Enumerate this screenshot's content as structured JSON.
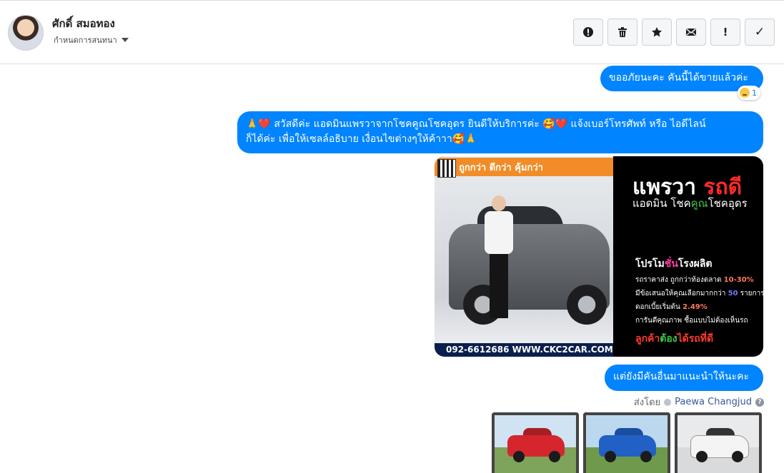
{
  "header": {
    "contact_name": "ศักดิ์ สมอทอง",
    "subtitle": "กำหนดการสนทนา",
    "actions": [
      {
        "icon": "alert-circle-icon",
        "glyph": ""
      },
      {
        "icon": "trash-icon",
        "glyph": ""
      },
      {
        "icon": "star-icon",
        "glyph": ""
      },
      {
        "icon": "envelope-icon",
        "glyph": ""
      },
      {
        "icon": "exclamation-icon",
        "glyph": "!"
      },
      {
        "icon": "checkmark-icon",
        "glyph": "✓"
      }
    ]
  },
  "messages": {
    "m1": "ขออภัยนะคะ คันนี้ได้ขายแล้วค่ะ",
    "m1_reaction_count": "1",
    "m2_line1": "🙏❤️ สวัสดีค่ะ แอดมินแพรวาจากโชคคูณโชคอุดร ยินดีให้บริการค่ะ 🥰❤️ แจ้งเบอร์โทรศัพท์ หรือ ไอดีไลน์",
    "m2_line2": "ก็ได้ค่ะ เพื่อให้เซลล์อธิบาย เงื่อนไขต่างๆให้ค้าาา🥰🙏",
    "m4": "แต่ยังมีคันอื่นมาแนะนำให้นะคะ"
  },
  "promo": {
    "banner": "ถูกกว่า ดีกว่า คุ้มกว่า",
    "brand_white": "แพรวา ",
    "brand_red": "รถดี",
    "tag_a": "แอดมิน โชค",
    "tag_green": "คูณ",
    "tag_b": "โชคอุดร",
    "promo_title_a": "โปรโม",
    "promo_title_pink": "ชั่น",
    "promo_title_b": "โรงผลิต",
    "line1_a": "รถราคาส่ง ถูกกว่าท้องตลาด ",
    "line1_hl": "10-30%",
    "line2_a": "มีข้อเสนอให้คุณเลือกมากกว่า ",
    "line2_hb": "50",
    "line2_b": " รายการ",
    "line3_a": "ดอกเบี้ยเริ่มต้น ",
    "line3_hl": "2.49%",
    "line4": "การันตีคุณภาพ ซื้อแบบไม่ต้องเห็นรถ",
    "cta_a": "ลูกค้า",
    "cta_green": "ต้อง",
    "cta_b": "ได้รถที่ดี",
    "phone": "092-6612686  WWW.CKC2CAR.COM"
  },
  "sent_by": {
    "prefix": "ส่งโดย",
    "name": "Paewa Changjud",
    "help": "?"
  },
  "colors": {
    "bubble": "#0084ff",
    "link": "#385898"
  }
}
